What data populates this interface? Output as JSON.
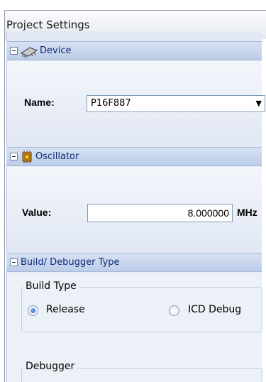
{
  "panel": {
    "title": "Project Settings"
  },
  "device": {
    "header": "Device",
    "name_label": "Name:",
    "name_value": "P16F887"
  },
  "oscillator": {
    "header": "Oscillator",
    "value_label": "Value:",
    "value": "8.000000",
    "unit": "MHz"
  },
  "build": {
    "header": "Build/ Debugger Type",
    "build_type_label": "Build Type",
    "options": [
      "Release",
      "ICD Debug"
    ],
    "selected": "Release",
    "debugger_label": "Debugger"
  },
  "colors": {
    "header_text": "#0f2a78",
    "section_header": "#c6d4ee",
    "radio_selected": "#1c5bbf"
  },
  "icons": {
    "device": "chip-icon",
    "oscillator": "oscillator-icon",
    "dropdown": "chevron-down-icon"
  }
}
